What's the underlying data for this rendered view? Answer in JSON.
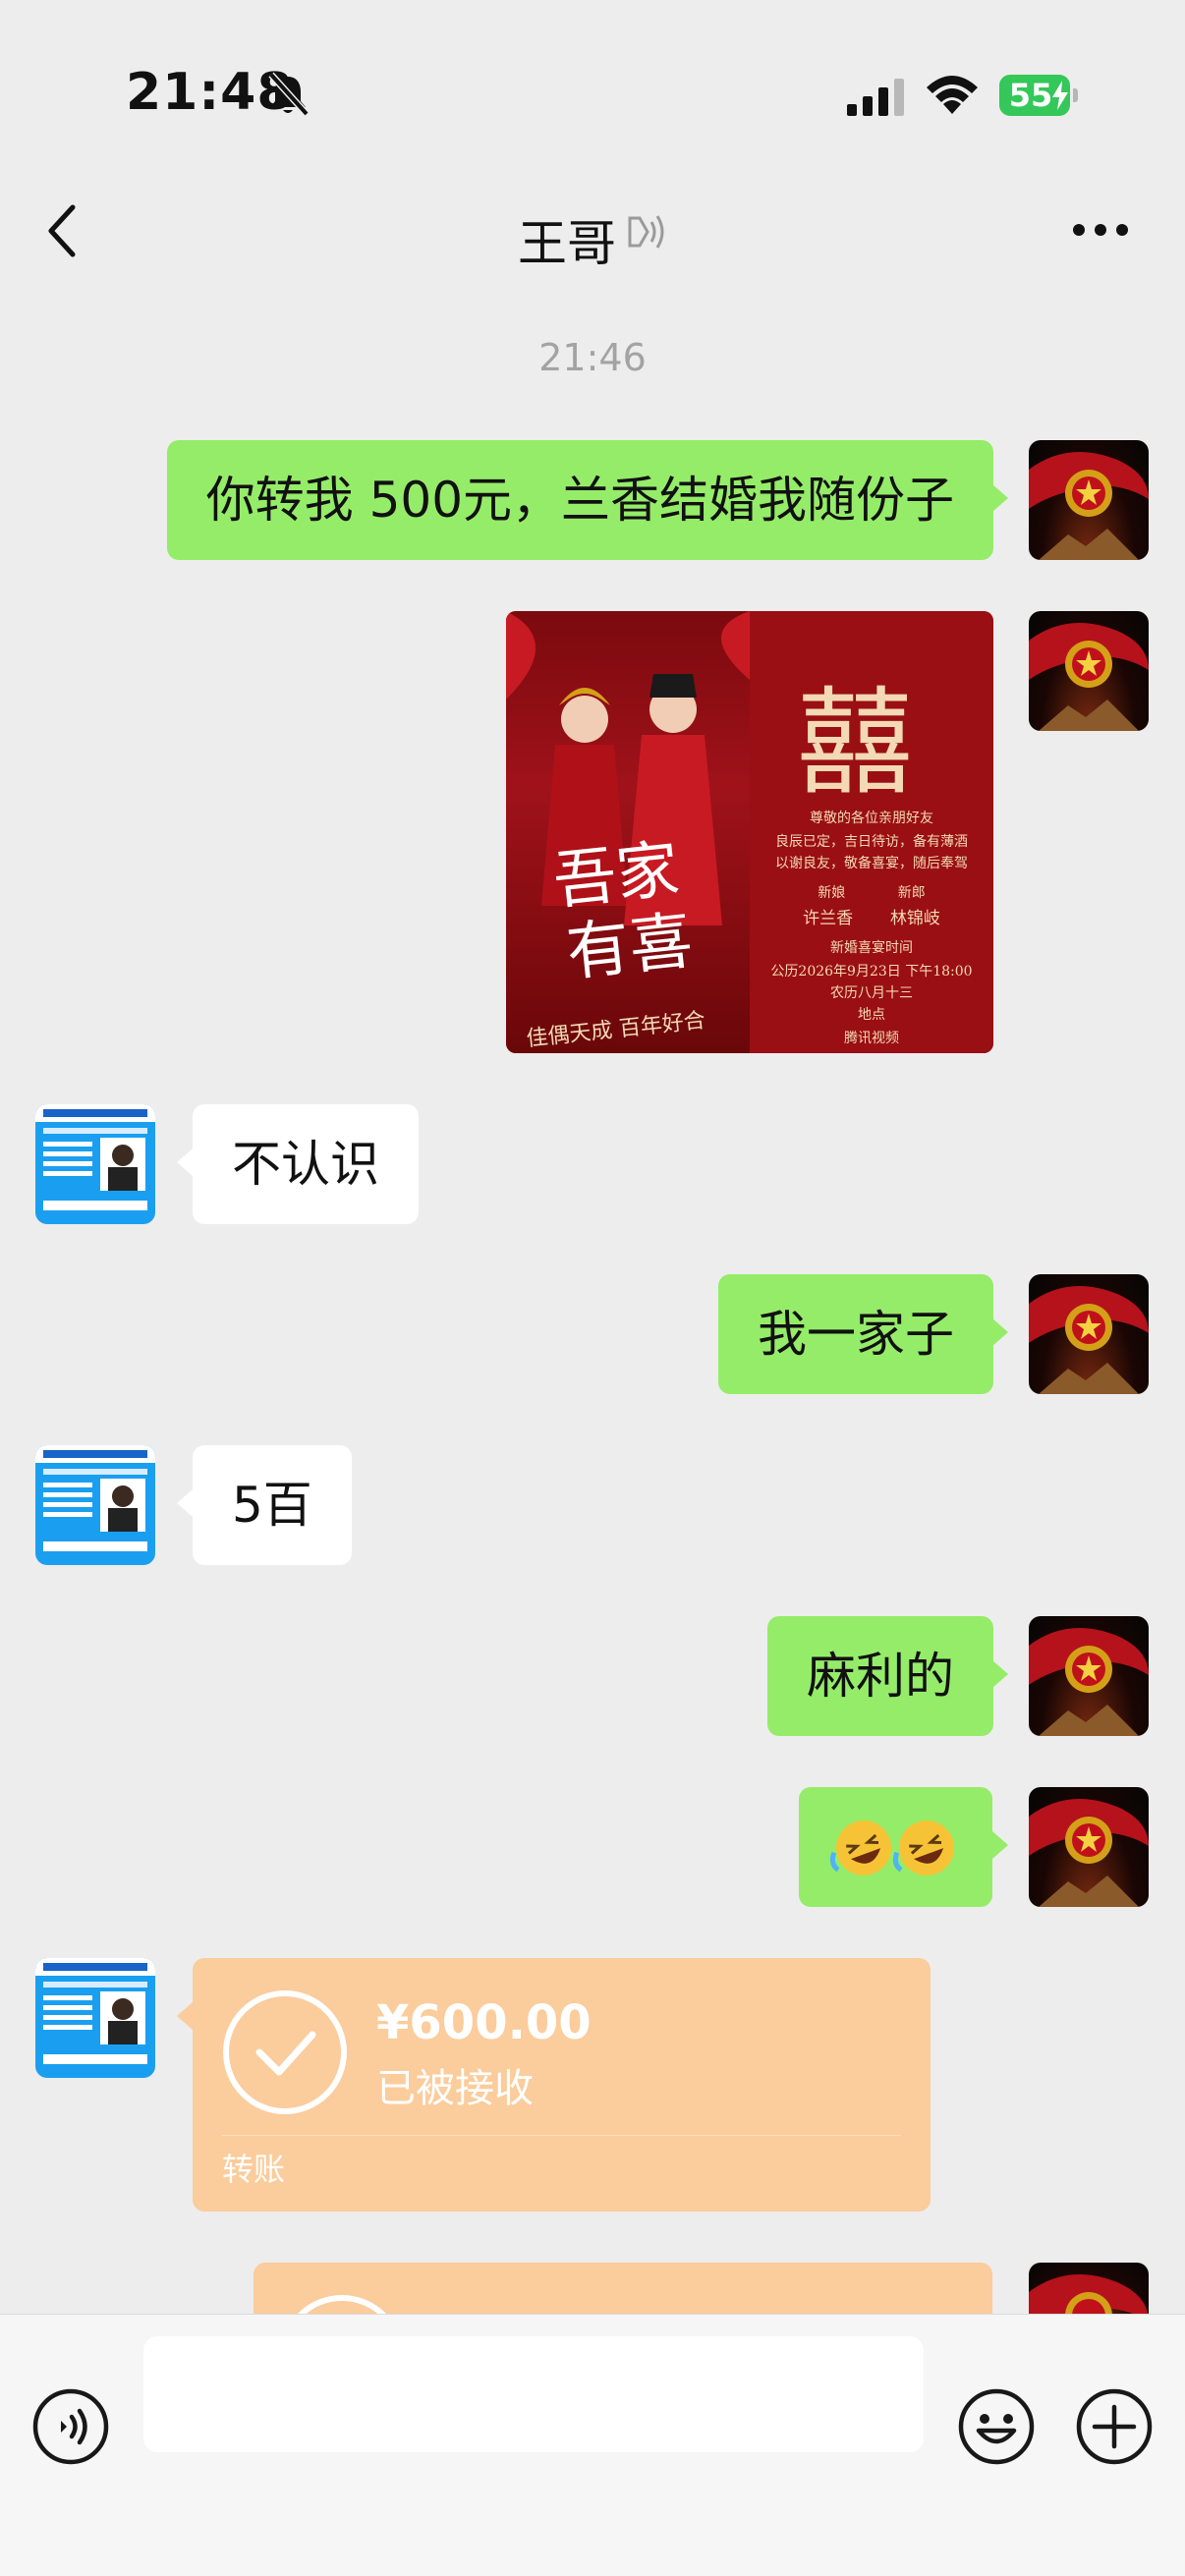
{
  "status_bar": {
    "time": "21:48",
    "battery": "55",
    "icons": [
      "bell-slash-icon",
      "signal-icon",
      "wifi-icon",
      "battery-icon"
    ]
  },
  "nav": {
    "title": "王哥",
    "icons": [
      "back-icon",
      "speaker-icon",
      "more-icon"
    ]
  },
  "chat": {
    "timestamp": "21:46",
    "messages": [
      {
        "side": "out",
        "type": "text",
        "text": "你转我 500元，兰香结婚我随份子"
      },
      {
        "side": "out",
        "type": "image"
      },
      {
        "side": "in",
        "type": "text",
        "text": "不认识"
      },
      {
        "side": "out",
        "type": "text",
        "text": "我一家子"
      },
      {
        "side": "in",
        "type": "text",
        "text": "5百"
      },
      {
        "side": "out",
        "type": "text",
        "text": "麻利的"
      },
      {
        "side": "out",
        "type": "emoji",
        "text": "🤣🤣"
      },
      {
        "side": "in",
        "type": "transfer",
        "amount": "¥600.00",
        "status": "已被接收",
        "label": "转账"
      },
      {
        "side": "out",
        "type": "transfer"
      }
    ]
  },
  "invitation": {
    "xi": "囍",
    "headline_1": "吾家",
    "headline_2": "有喜",
    "greeting": "尊敬的各位亲朋好友",
    "line_1": "良辰已定，吉日待访，备有薄酒",
    "line_2": "以谢良友，敬备喜宴，随后奉驾",
    "bride_label": "新娘",
    "groom_label": "新郎",
    "bride": "许兰香",
    "groom": "林锦岐",
    "time_title": "新婚喜宴时间",
    "date": "公历2026年9月23日  下午18:00",
    "lunar": "农历八月十三",
    "venue_title": "地点",
    "venue": "腾讯视频",
    "footer": "佳偶天成  百年好合"
  },
  "input_bar": {
    "placeholder": "",
    "icons": [
      "voice-icon",
      "emoji-icon",
      "plus-icon"
    ]
  },
  "colors": {
    "background": "#ededed",
    "outgoing_bubble": "#95ec69",
    "incoming_bubble": "#ffffff",
    "transfer_card": "#fbcc9c",
    "battery": "#34c759"
  }
}
